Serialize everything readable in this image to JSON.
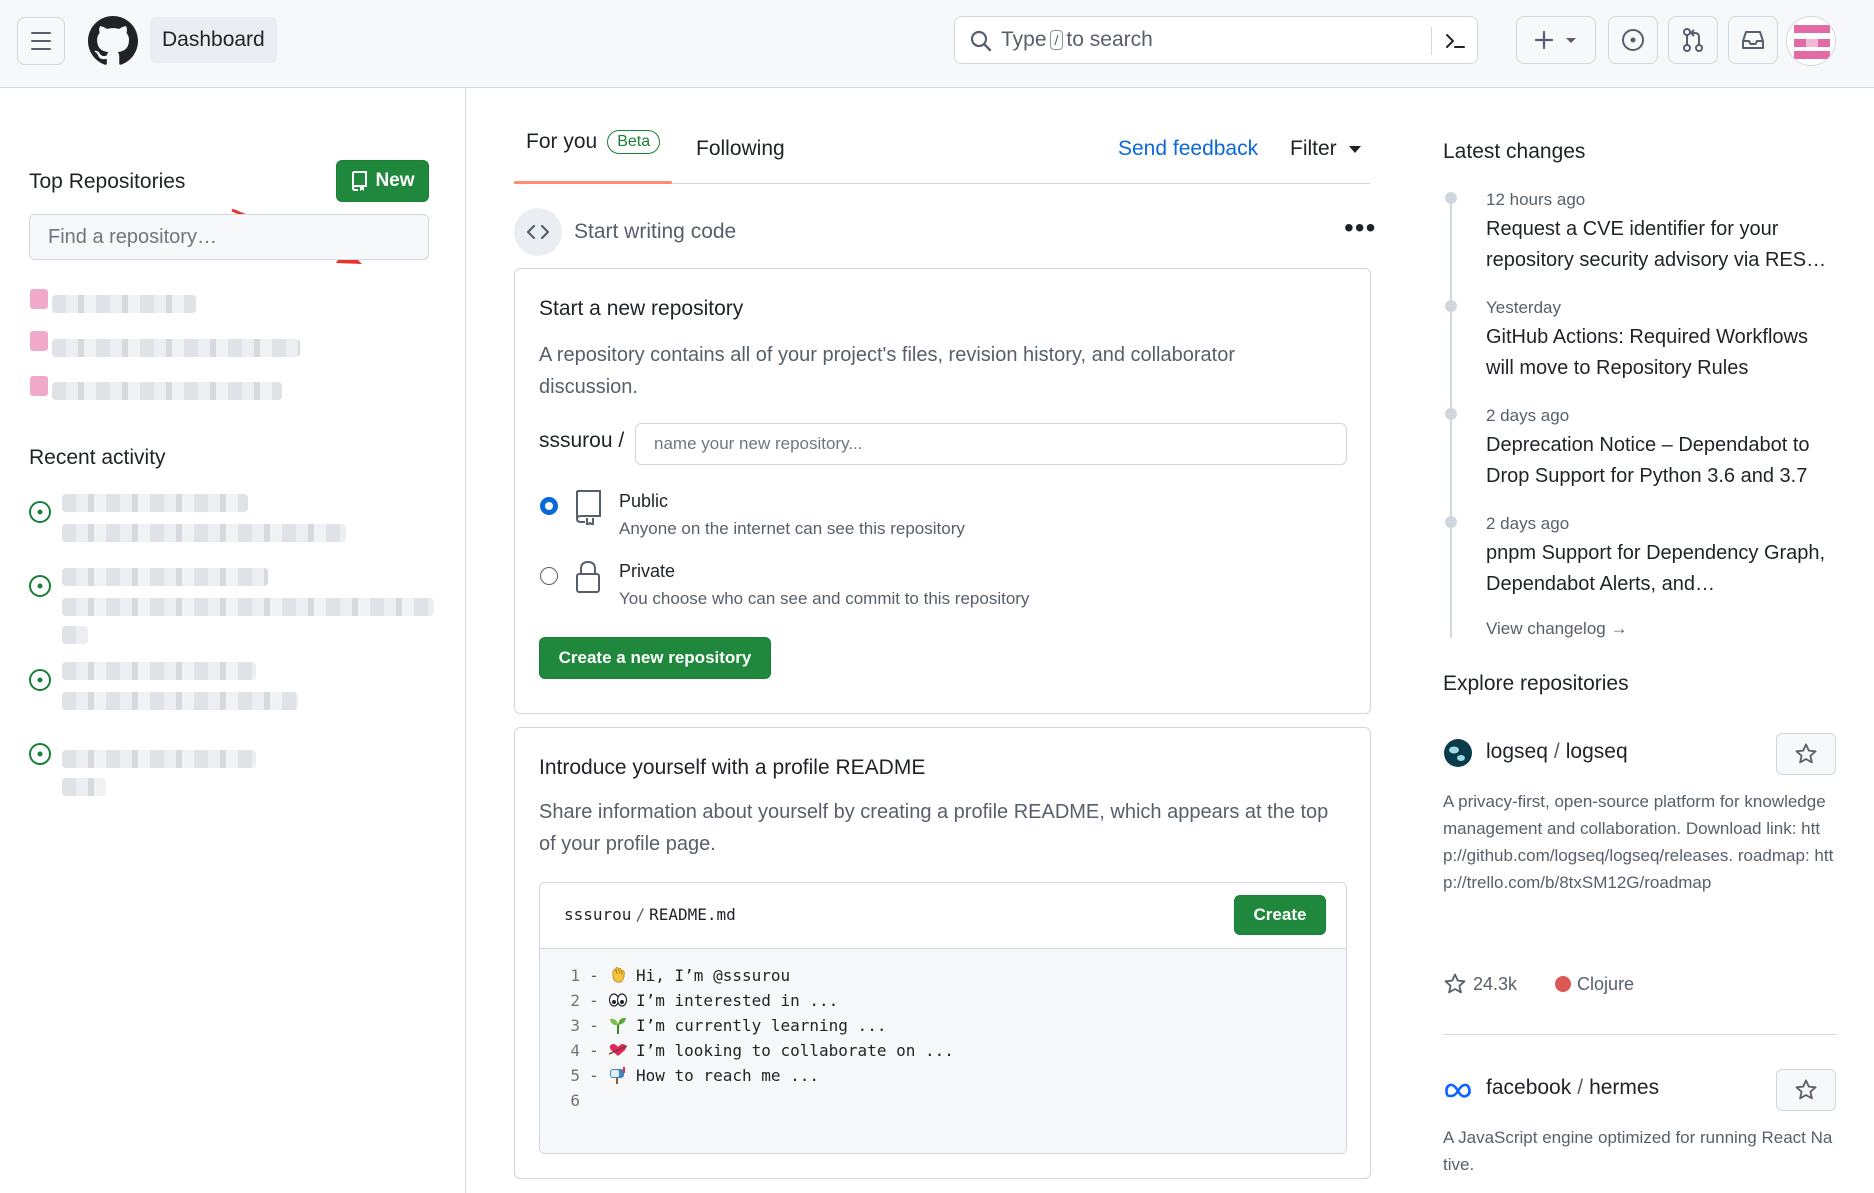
{
  "header": {
    "dashboard_label": "Dashboard",
    "search": {
      "prefix": "Type",
      "key": "/",
      "suffix": "to search"
    }
  },
  "sidebar": {
    "top_repos_title": "Top Repositories",
    "new_button": "New",
    "find_placeholder": "Find a repository…",
    "recent_activity_title": "Recent activity"
  },
  "feed": {
    "tab_for_you": "For you",
    "beta_badge": "Beta",
    "tab_following": "Following",
    "send_feedback": "Send feedback",
    "filter": "Filter",
    "start_writing": "Start writing code"
  },
  "new_repo_card": {
    "title": "Start a new repository",
    "description": "A repository contains all of your project's files, revision history, and collaborator discussion.",
    "owner": "sssurou /",
    "name_placeholder": "name your new repository...",
    "public_title": "Public",
    "public_desc": "Anyone on the internet can see this repository",
    "private_title": "Private",
    "private_desc": "You choose who can see and commit to this repository",
    "selected_visibility": "Public",
    "create_button": "Create a new repository"
  },
  "readme_card": {
    "title": "Introduce yourself with a profile README",
    "description": "Share information about yourself by creating a profile README, which appears at the top of your profile page.",
    "path_owner": "sssurou",
    "path_file": "README.md",
    "create_button": "Create",
    "lines": [
      {
        "num": "1",
        "dash": "-",
        "emoji": "wave-emoji",
        "text": "Hi, I’m @sssurou"
      },
      {
        "num": "2",
        "dash": "-",
        "emoji": "eyes-emoji",
        "text": "I’m interested in ..."
      },
      {
        "num": "3",
        "dash": "-",
        "emoji": "seedling-emoji",
        "text": "I’m currently learning ..."
      },
      {
        "num": "4",
        "dash": "-",
        "emoji": "heart-emoji",
        "text": "I’m looking to collaborate on ..."
      },
      {
        "num": "5",
        "dash": "-",
        "emoji": "mailbox-emoji",
        "text": "How to reach me ..."
      },
      {
        "num": "6",
        "dash": "",
        "emoji": "",
        "text": ""
      }
    ]
  },
  "latest_changes": {
    "title": "Latest changes",
    "items": [
      {
        "time": "12 hours ago",
        "text": "Request a CVE identifier for your repository security advisory via RES…"
      },
      {
        "time": "Yesterday",
        "text": "GitHub Actions: Required Workflows will move to Repository Rules"
      },
      {
        "time": "2 days ago",
        "text": "Deprecation Notice – Dependabot to Drop Support for Python 3.6 and 3.7"
      },
      {
        "time": "2 days ago",
        "text": "pnpm Support for Dependency Graph, Dependabot Alerts, and…"
      }
    ],
    "view_changelog": "View changelog →"
  },
  "explore": {
    "title": "Explore repositories",
    "repos": [
      {
        "owner": "logseq",
        "name": "logseq",
        "description": "A privacy-first, open-source platform for knowledge management and collaboration. Download link: http://github.com/logseq/logseq/releases. roadmap: http://trello.com/b/8txSM12G/roadmap",
        "stars": "24.3k",
        "language": "Clojure",
        "language_color": "#db5855"
      },
      {
        "owner": "facebook",
        "name": "hermes",
        "description": "A JavaScript engine optimized for running React Native."
      }
    ]
  },
  "colors": {
    "primary_green": "#1f883d",
    "link_blue": "#0969da",
    "tab_accent": "#fd8c73",
    "annotation_arrow": "#e8322e"
  }
}
